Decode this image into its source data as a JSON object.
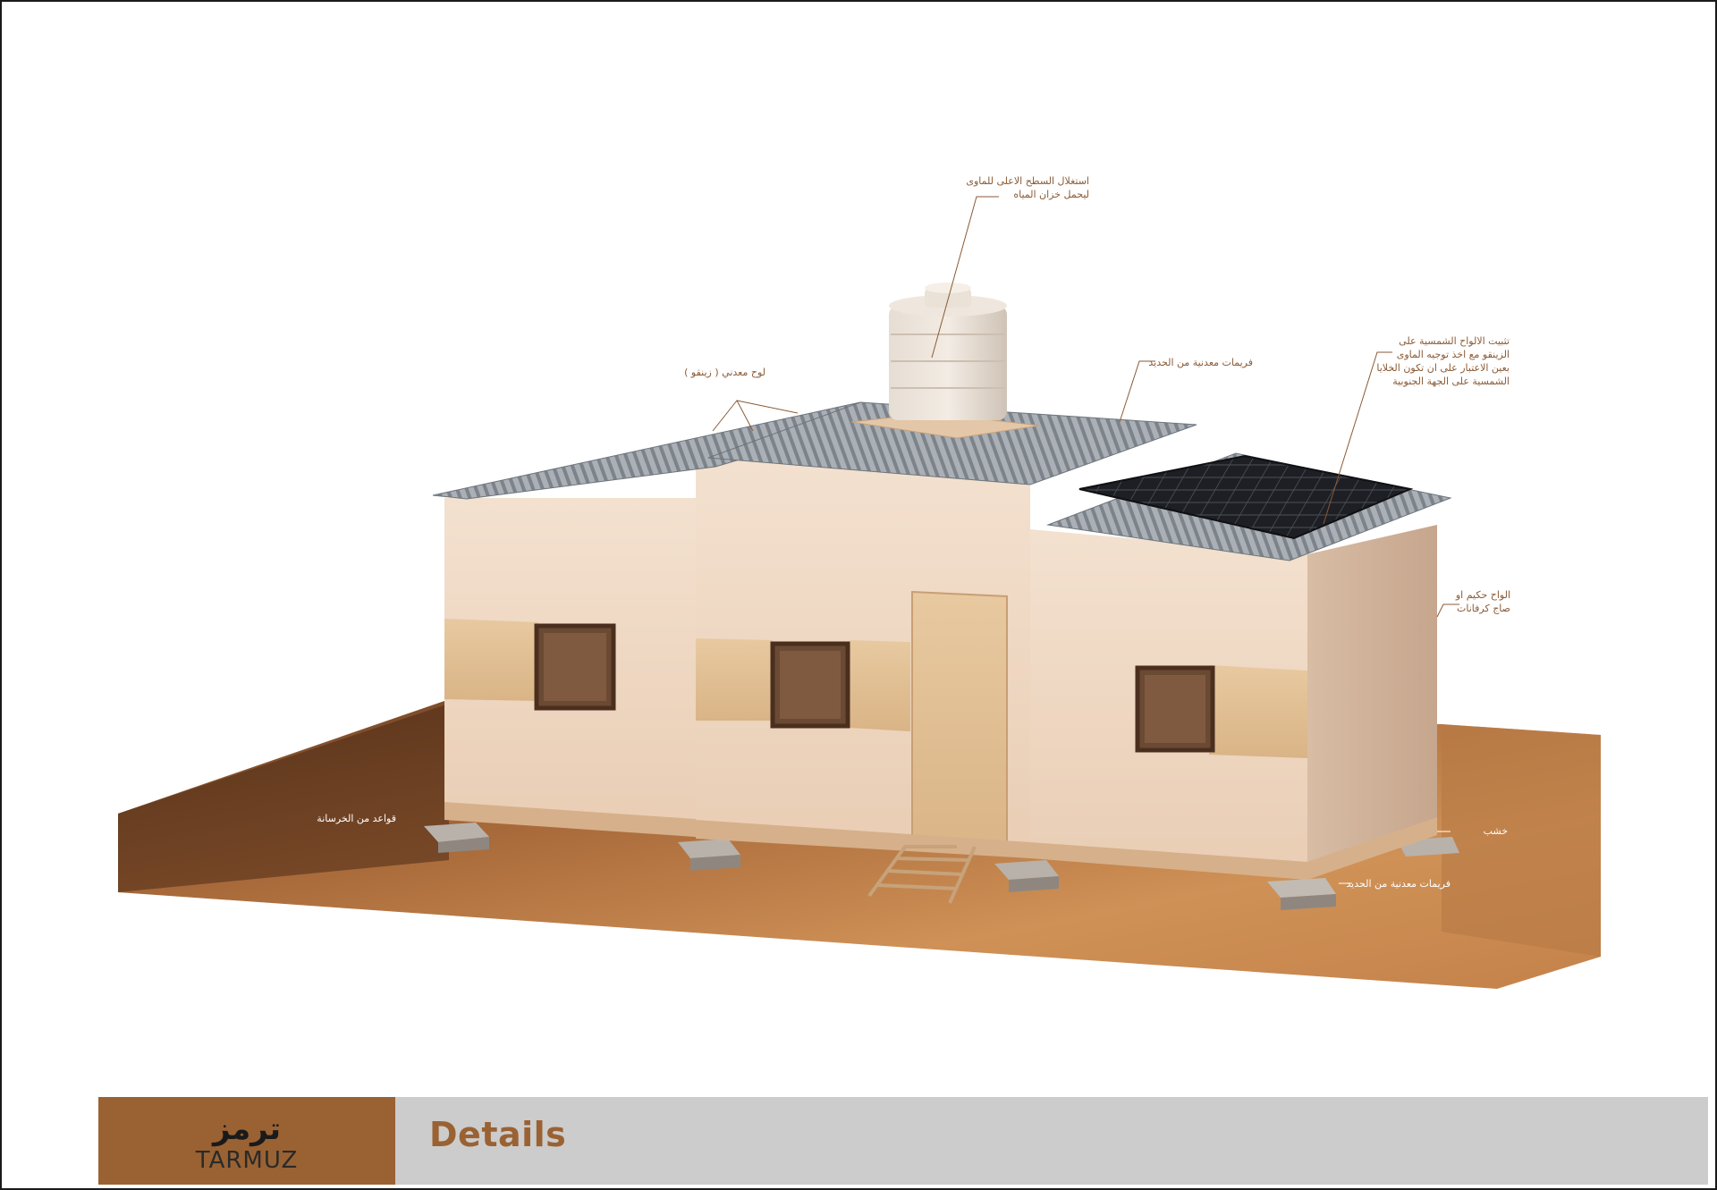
{
  "annotations": {
    "tank": [
      "استغلال السطح الاعلى للماوى",
      "ليحمل خزان المياه"
    ],
    "zinc": "لوح معدني ( زينقو )",
    "frame_top": "فريمات معدنية من الحديد",
    "solar": [
      "تثبيت الالواح الشمسية على",
      "الزينقو مع اخذ توجيه الماوى",
      "بعين الاعتبار على ان تكون الخلايا",
      "الشمسية على الجهة الجنوبية"
    ],
    "walls": [
      "الواح حكيم او",
      "صاج كرفانات"
    ],
    "wood": "خشب",
    "frame_bottom": "فريمات معدنية من الحديد",
    "concrete": "قواعد من الخرسانة"
  },
  "footer": {
    "brand_arabic": "ترمز",
    "brand_latin": "TARMUZ",
    "title": "Details"
  },
  "colors": {
    "brand": "#9a6233",
    "footer_grey": "#cccccc",
    "ground": "#c88a4c",
    "wall": "#f0dcc8"
  }
}
